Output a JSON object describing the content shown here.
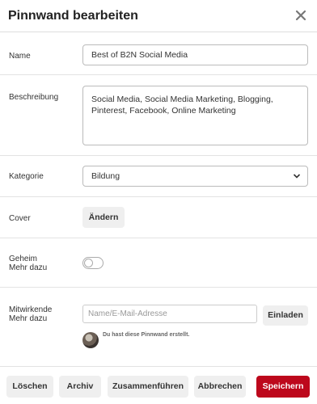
{
  "dialog": {
    "title": "Pinnwand bearbeiten"
  },
  "fields": {
    "name": {
      "label": "Name",
      "value": "Best of B2N Social Media"
    },
    "description": {
      "label": "Beschreibung",
      "value": "Social Media, Social Media Marketing, Blogging, Pinterest, Facebook, Online Marketing"
    },
    "category": {
      "label": "Kategorie",
      "value": "Bildung"
    },
    "cover": {
      "label": "Cover",
      "button": "Ändern"
    },
    "secret": {
      "label_line1": "Geheim",
      "label_line2": "Mehr dazu",
      "enabled": false
    },
    "collaborators": {
      "label_line1": "Mitwirkende",
      "label_line2": "Mehr dazu",
      "placeholder": "Name/E-Mail-Adresse",
      "invite_button": "Einladen",
      "created_note": "Du hast diese Pinnwand erstellt."
    }
  },
  "footer": {
    "delete": "Löschen",
    "archive": "Archiv",
    "merge": "Zusammenführen",
    "cancel": "Abbrechen",
    "save": "Speichern"
  },
  "colors": {
    "save_button": "#bd081c"
  }
}
